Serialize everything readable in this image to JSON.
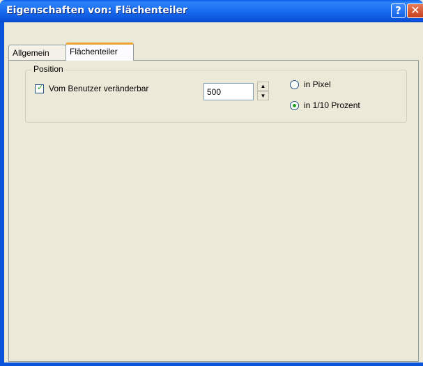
{
  "window": {
    "title": "Eigenschaften von: Flächenteiler",
    "help_icon": "question-mark",
    "close_icon": "x-close",
    "help_label": "?",
    "close_label": "✕"
  },
  "tabs": [
    {
      "label": "Allgemein",
      "selected": false
    },
    {
      "label": "Flächenteiler",
      "selected": true
    }
  ],
  "position_group": {
    "legend": "Position",
    "user_changeable": {
      "label": "Vom Benutzer veränderbar",
      "checked": true,
      "mark": "✓"
    },
    "value": "500",
    "spinner": {
      "up": "▲",
      "down": "▼"
    },
    "unit_options": [
      {
        "label": "in Pixel",
        "selected": false
      },
      {
        "label": "in 1/10 Prozent",
        "selected": true
      }
    ]
  },
  "colors": {
    "titlebar": "#0a54dc",
    "dialog_background": "#ece9d8",
    "selected_tab_accent": "#e8a330",
    "check_green": "#21a121"
  }
}
